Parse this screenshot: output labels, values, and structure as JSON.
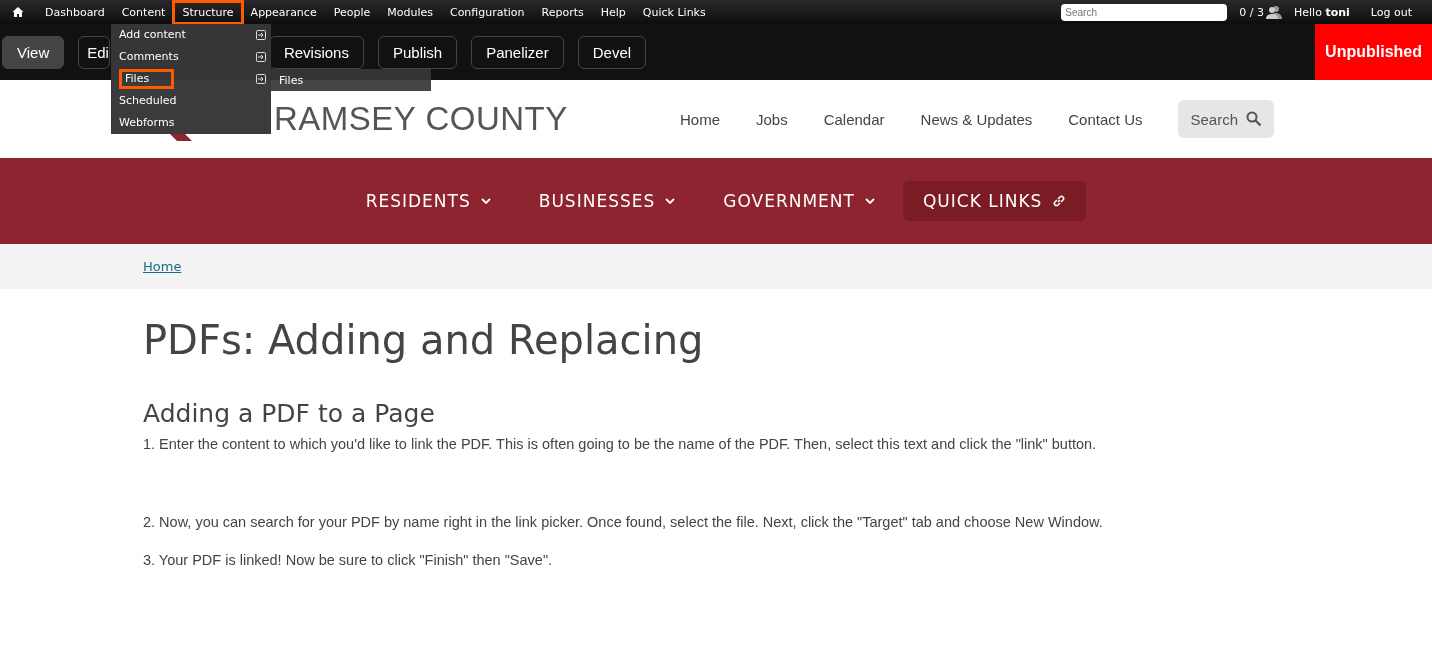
{
  "toolbar": {
    "items": [
      {
        "label": "Dashboard",
        "highlighted": false
      },
      {
        "label": "Content",
        "highlighted": false
      },
      {
        "label": "Structure",
        "highlighted": true
      },
      {
        "label": "Appearance",
        "highlighted": false
      },
      {
        "label": "People",
        "highlighted": false
      },
      {
        "label": "Modules",
        "highlighted": false
      },
      {
        "label": "Configuration",
        "highlighted": false
      },
      {
        "label": "Reports",
        "highlighted": false
      },
      {
        "label": "Help",
        "highlighted": false
      },
      {
        "label": "Quick Links",
        "highlighted": false
      }
    ],
    "search": {
      "placeholder": "Search"
    },
    "users": "0 / 3",
    "hello": "Hello **toni**",
    "logout": "Log out"
  },
  "structure_menu": [
    {
      "label": "Add content",
      "has_submenu": true,
      "highlighted": false
    },
    {
      "label": "Comments",
      "has_submenu": true,
      "highlighted": false
    },
    {
      "label": "Files",
      "has_submenu": true,
      "highlighted": true
    },
    {
      "label": "Scheduled",
      "has_submenu": false,
      "highlighted": false
    },
    {
      "label": "Webforms",
      "has_submenu": false,
      "highlighted": false
    }
  ],
  "submenu": [
    "Files"
  ],
  "tabs": [
    {
      "label": "View",
      "selected": true
    },
    {
      "label": "Edi",
      "selected": false
    },
    {
      "label": "Revisions",
      "selected": false
    },
    {
      "label": "Publish",
      "selected": false
    },
    {
      "label": "Panelizer",
      "selected": false
    },
    {
      "label": "Devel",
      "selected": false
    }
  ],
  "status": "Unpublished",
  "site": {
    "name": "RAMSEY COUNTY",
    "nav": [
      "Home",
      "Jobs",
      "Calendar",
      "News & Updates",
      "Contact Us"
    ],
    "search": "Search"
  },
  "main_nav": [
    {
      "label": "RESIDENTS",
      "kind": "dropdown"
    },
    {
      "label": "BUSINESSES",
      "kind": "dropdown"
    },
    {
      "label": "GOVERNMENT",
      "kind": "dropdown"
    },
    {
      "label": "QUICK LINKS",
      "kind": "link"
    }
  ],
  "breadcrumb": [
    "Home"
  ],
  "title": "PDFs: Adding and Replacing",
  "section": "Adding a PDF to a Page",
  "steps": [
    "1. Enter the content to which you'd like to link the PDF. This is often going to be the name of the PDF. Then, select this text and click the \"link\" button.",
    "2. Now, you can search for your PDF by name right in the link picker. Once found, select the file. Next, click the \"Target\" tab and choose New Window.",
    "3. Your PDF is linked! Now be sure to click \"Finish\" then \"Save\"."
  ]
}
